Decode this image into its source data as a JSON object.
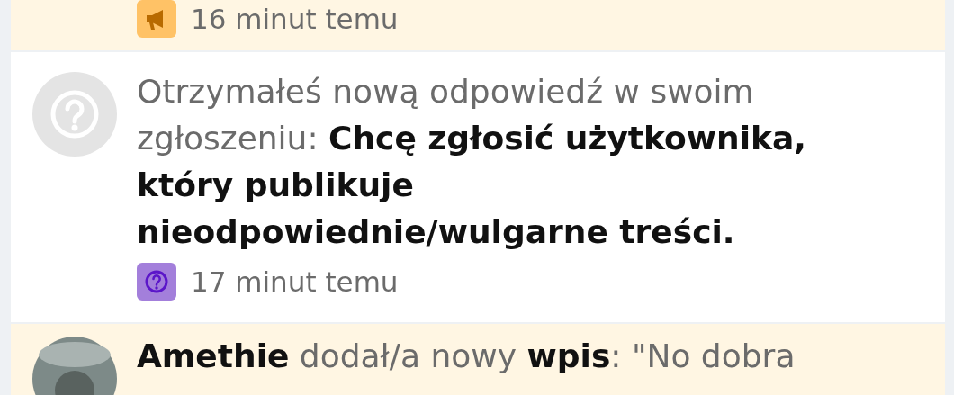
{
  "notifications": [
    {
      "unread": true,
      "badge": {
        "kind": "megaphone"
      },
      "time": "16 minut temu"
    },
    {
      "unread": false,
      "avatar": {
        "kind": "question"
      },
      "text": "Otrzymałeś nową odpowiedź w swoim zgłoszeniu: **Chcę zgłosić użytkownika, który publikuje nieodpowiednie/wulgarne treści.**",
      "badge": {
        "kind": "question"
      },
      "time": "17 minut temu"
    },
    {
      "unread": true,
      "text": "**Amethie** dodał/a nowy **wpis**: \"No dobra"
    }
  ]
}
